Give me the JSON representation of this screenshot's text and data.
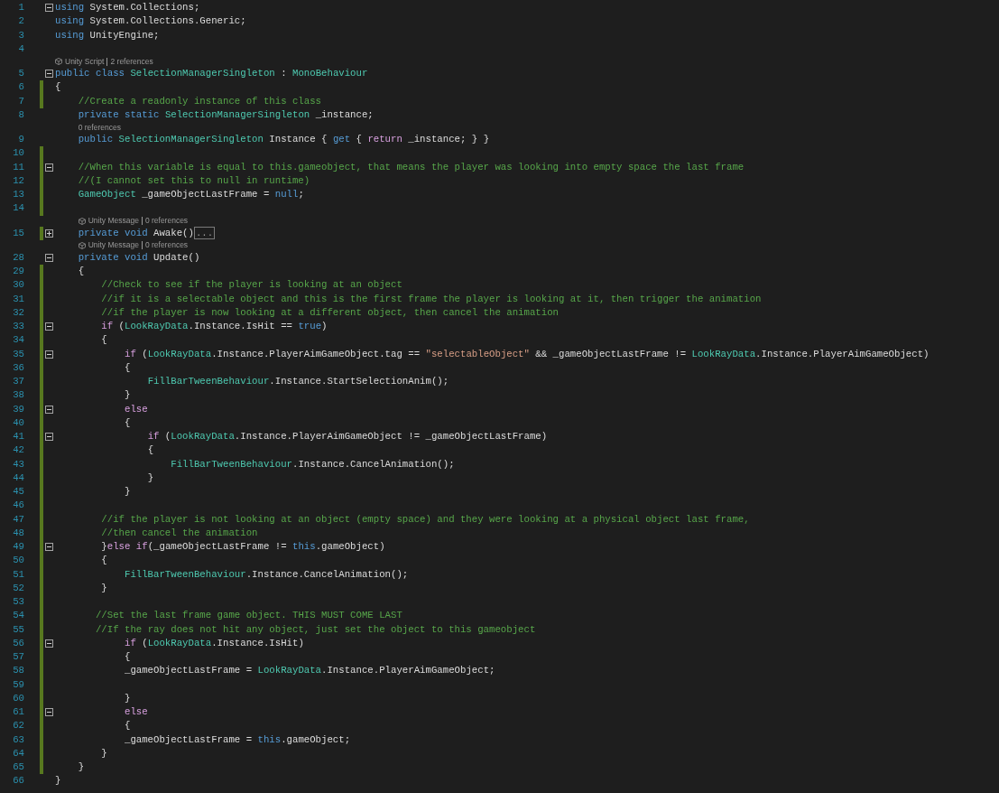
{
  "editor": {
    "lines": [
      {
        "kind": "code",
        "number": "1",
        "modified": false,
        "fold": {
          "expanded": true
        },
        "tokens": [
          {
            "kind": "keyword",
            "text": "using"
          },
          {
            "kind": "plain",
            "text": " System.Collections;"
          }
        ]
      },
      {
        "kind": "code",
        "number": "2",
        "modified": false,
        "tokens": [
          {
            "kind": "keyword",
            "text": "using"
          },
          {
            "kind": "plain",
            "text": " System.Collections.Generic;"
          }
        ]
      },
      {
        "kind": "code",
        "number": "3",
        "modified": false,
        "tokens": [
          {
            "kind": "keyword",
            "text": "using"
          },
          {
            "kind": "plain",
            "text": " UnityEngine;"
          }
        ]
      },
      {
        "kind": "code",
        "number": "4",
        "modified": false
      },
      {
        "kind": "lens",
        "items": [
          {
            "kind": "source",
            "text": "Unity Script"
          },
          {
            "kind": "references",
            "text": "2 references"
          }
        ]
      },
      {
        "kind": "code",
        "number": "5",
        "modified": false,
        "fold": {
          "expanded": true
        },
        "tokens": [
          {
            "kind": "keyword",
            "text": "public class "
          },
          {
            "kind": "type",
            "text": "SelectionManagerSingleton"
          },
          {
            "kind": "plain",
            "text": " : "
          },
          {
            "kind": "type",
            "text": "MonoBehaviour"
          }
        ]
      },
      {
        "kind": "code",
        "number": "6",
        "modified": true,
        "tokens": [
          {
            "kind": "plain",
            "text": "{"
          }
        ]
      },
      {
        "kind": "code",
        "number": "7",
        "modified": true,
        "tokens": [
          {
            "kind": "comment",
            "text": "    //Create a readonly instance of this class"
          }
        ]
      },
      {
        "kind": "code",
        "number": "8",
        "modified": false,
        "tokens": [
          {
            "kind": "keyword",
            "text": "    private static "
          },
          {
            "kind": "type",
            "text": "SelectionManagerSingleton"
          },
          {
            "kind": "plain",
            "text": " _instance;"
          }
        ]
      },
      {
        "kind": "lens",
        "items": [
          {
            "kind": "references",
            "text": "0 references"
          }
        ]
      },
      {
        "kind": "code",
        "number": "9",
        "modified": false,
        "tokens": [
          {
            "kind": "keyword",
            "text": "    public "
          },
          {
            "kind": "type",
            "text": "SelectionManagerSingleton"
          },
          {
            "kind": "plain",
            "text": " Instance { "
          },
          {
            "kind": "keyword",
            "text": "get"
          },
          {
            "kind": "plain",
            "text": " { "
          },
          {
            "kind": "control",
            "text": "return"
          },
          {
            "kind": "plain",
            "text": " _instance; } }"
          }
        ]
      },
      {
        "kind": "code",
        "number": "10",
        "modified": true
      },
      {
        "kind": "code",
        "number": "11",
        "modified": true,
        "fold": {
          "expanded": true
        },
        "tokens": [
          {
            "kind": "comment",
            "text": "    //When this variable is equal to this.gameobject, that means the player was looking into empty space the last frame"
          }
        ]
      },
      {
        "kind": "code",
        "number": "12",
        "modified": true,
        "tokens": [
          {
            "kind": "comment",
            "text": "    //(I cannot set this to null in runtime)"
          }
        ]
      },
      {
        "kind": "code",
        "number": "13",
        "modified": true,
        "tokens": [
          {
            "kind": "type",
            "text": "    GameObject"
          },
          {
            "kind": "plain",
            "text": " _gameObjectLastFrame = "
          },
          {
            "kind": "keyword",
            "text": "null"
          },
          {
            "kind": "plain",
            "text": ";"
          }
        ]
      },
      {
        "kind": "code",
        "number": "14",
        "modified": true
      },
      {
        "kind": "lens",
        "items": [
          {
            "kind": "source",
            "text": "Unity Message"
          },
          {
            "kind": "references",
            "text": "0 references"
          }
        ]
      },
      {
        "kind": "code",
        "number": "15",
        "modified": true,
        "fold": {
          "expanded": false
        },
        "tokens": [
          {
            "kind": "keyword",
            "text": "    private void"
          },
          {
            "kind": "plain",
            "text": " Awake()"
          }
        ],
        "collapsed_indicator": "..."
      },
      {
        "kind": "lens",
        "items": [
          {
            "kind": "source",
            "text": "Unity Message"
          },
          {
            "kind": "references",
            "text": "0 references"
          }
        ]
      },
      {
        "kind": "code",
        "number": "28",
        "modified": false,
        "fold": {
          "expanded": true
        },
        "tokens": [
          {
            "kind": "keyword",
            "text": "    private void"
          },
          {
            "kind": "plain",
            "text": " Update()"
          }
        ]
      },
      {
        "kind": "code",
        "number": "29",
        "modified": true,
        "tokens": [
          {
            "kind": "plain",
            "text": "    {"
          }
        ]
      },
      {
        "kind": "code",
        "number": "30",
        "modified": true,
        "tokens": [
          {
            "kind": "comment",
            "text": "        //Check to see if the player is looking at an object"
          }
        ]
      },
      {
        "kind": "code",
        "number": "31",
        "modified": true,
        "tokens": [
          {
            "kind": "comment",
            "text": "        //if it is a selectable object and this is the first frame the player is looking at it, then trigger the animation"
          }
        ]
      },
      {
        "kind": "code",
        "number": "32",
        "modified": true,
        "tokens": [
          {
            "kind": "comment",
            "text": "        //if the player is now looking at a different object, then cancel the animation"
          }
        ]
      },
      {
        "kind": "code",
        "number": "33",
        "modified": true,
        "fold": {
          "expanded": true
        },
        "tokens": [
          {
            "kind": "control",
            "text": "        if"
          },
          {
            "kind": "plain",
            "text": " ("
          },
          {
            "kind": "type",
            "text": "LookRayData"
          },
          {
            "kind": "plain",
            "text": ".Instance.IsHit == "
          },
          {
            "kind": "keyword",
            "text": "true"
          },
          {
            "kind": "plain",
            "text": ")"
          }
        ]
      },
      {
        "kind": "code",
        "number": "34",
        "modified": true,
        "tokens": [
          {
            "kind": "plain",
            "text": "        {"
          }
        ]
      },
      {
        "kind": "code",
        "number": "35",
        "modified": true,
        "fold": {
          "expanded": true
        },
        "tokens": [
          {
            "kind": "control",
            "text": "            if"
          },
          {
            "kind": "plain",
            "text": " ("
          },
          {
            "kind": "type",
            "text": "LookRayData"
          },
          {
            "kind": "plain",
            "text": ".Instance.PlayerAimGameObject.tag == "
          },
          {
            "kind": "string",
            "text": "\"selectableObject\""
          },
          {
            "kind": "plain",
            "text": " && _gameObjectLastFrame != "
          },
          {
            "kind": "type",
            "text": "LookRayData"
          },
          {
            "kind": "plain",
            "text": ".Instance.PlayerAimGameObject)"
          }
        ]
      },
      {
        "kind": "code",
        "number": "36",
        "modified": true,
        "tokens": [
          {
            "kind": "plain",
            "text": "            {"
          }
        ]
      },
      {
        "kind": "code",
        "number": "37",
        "modified": true,
        "tokens": [
          {
            "kind": "type",
            "text": "                FillBarTweenBehaviour"
          },
          {
            "kind": "plain",
            "text": ".Instance.StartSelectionAnim();"
          }
        ]
      },
      {
        "kind": "code",
        "number": "38",
        "modified": true,
        "tokens": [
          {
            "kind": "plain",
            "text": "            }"
          }
        ]
      },
      {
        "kind": "code",
        "number": "39",
        "modified": true,
        "fold": {
          "expanded": true
        },
        "tokens": [
          {
            "kind": "control",
            "text": "            else"
          }
        ]
      },
      {
        "kind": "code",
        "number": "40",
        "modified": true,
        "tokens": [
          {
            "kind": "plain",
            "text": "            {"
          }
        ]
      },
      {
        "kind": "code",
        "number": "41",
        "modified": true,
        "fold": {
          "expanded": true
        },
        "tokens": [
          {
            "kind": "control",
            "text": "                if"
          },
          {
            "kind": "plain",
            "text": " ("
          },
          {
            "kind": "type",
            "text": "LookRayData"
          },
          {
            "kind": "plain",
            "text": ".Instance.PlayerAimGameObject != _gameObjectLastFrame)"
          }
        ]
      },
      {
        "kind": "code",
        "number": "42",
        "modified": true,
        "tokens": [
          {
            "kind": "plain",
            "text": "                {"
          }
        ]
      },
      {
        "kind": "code",
        "number": "43",
        "modified": true,
        "tokens": [
          {
            "kind": "type",
            "text": "                    FillBarTweenBehaviour"
          },
          {
            "kind": "plain",
            "text": ".Instance.CancelAnimation();"
          }
        ]
      },
      {
        "kind": "code",
        "number": "44",
        "modified": true,
        "tokens": [
          {
            "kind": "plain",
            "text": "                }"
          }
        ]
      },
      {
        "kind": "code",
        "number": "45",
        "modified": true,
        "tokens": [
          {
            "kind": "plain",
            "text": "            }"
          }
        ]
      },
      {
        "kind": "code",
        "number": "46",
        "modified": true
      },
      {
        "kind": "code",
        "number": "47",
        "modified": true,
        "tokens": [
          {
            "kind": "comment",
            "text": "        //if the player is not looking at an object (empty space) and they were looking at a physical object last frame,"
          }
        ]
      },
      {
        "kind": "code",
        "number": "48",
        "modified": true,
        "tokens": [
          {
            "kind": "comment",
            "text": "        //then cancel the animation"
          }
        ]
      },
      {
        "kind": "code",
        "number": "49",
        "modified": true,
        "fold": {
          "expanded": true
        },
        "tokens": [
          {
            "kind": "plain",
            "text": "        }"
          },
          {
            "kind": "control",
            "text": "else if"
          },
          {
            "kind": "plain",
            "text": "(_gameObjectLastFrame != "
          },
          {
            "kind": "keyword",
            "text": "this"
          },
          {
            "kind": "plain",
            "text": ".gameObject)"
          }
        ]
      },
      {
        "kind": "code",
        "number": "50",
        "modified": true,
        "tokens": [
          {
            "kind": "plain",
            "text": "        {"
          }
        ]
      },
      {
        "kind": "code",
        "number": "51",
        "modified": true,
        "tokens": [
          {
            "kind": "type",
            "text": "            FillBarTweenBehaviour"
          },
          {
            "kind": "plain",
            "text": ".Instance.CancelAnimation();"
          }
        ]
      },
      {
        "kind": "code",
        "number": "52",
        "modified": true,
        "tokens": [
          {
            "kind": "plain",
            "text": "        }"
          }
        ]
      },
      {
        "kind": "code",
        "number": "53",
        "modified": true
      },
      {
        "kind": "code",
        "number": "54",
        "modified": true,
        "tokens": [
          {
            "kind": "comment",
            "text": "       //Set the last frame game object. THIS MUST COME LAST"
          }
        ]
      },
      {
        "kind": "code",
        "number": "55",
        "modified": true,
        "tokens": [
          {
            "kind": "comment",
            "text": "       //If the ray does not hit any object, just set the object to this gameobject"
          }
        ]
      },
      {
        "kind": "code",
        "number": "56",
        "modified": true,
        "fold": {
          "expanded": true
        },
        "tokens": [
          {
            "kind": "control",
            "text": "            if"
          },
          {
            "kind": "plain",
            "text": " ("
          },
          {
            "kind": "type",
            "text": "LookRayData"
          },
          {
            "kind": "plain",
            "text": ".Instance.IsHit)"
          }
        ]
      },
      {
        "kind": "code",
        "number": "57",
        "modified": true,
        "tokens": [
          {
            "kind": "plain",
            "text": "            {"
          }
        ]
      },
      {
        "kind": "code",
        "number": "58",
        "modified": true,
        "tokens": [
          {
            "kind": "plain",
            "text": "            _gameObjectLastFrame = "
          },
          {
            "kind": "type",
            "text": "LookRayData"
          },
          {
            "kind": "plain",
            "text": ".Instance.PlayerAimGameObject;"
          }
        ]
      },
      {
        "kind": "code",
        "number": "59",
        "modified": true
      },
      {
        "kind": "code",
        "number": "60",
        "modified": true,
        "tokens": [
          {
            "kind": "plain",
            "text": "            }"
          }
        ]
      },
      {
        "kind": "code",
        "number": "61",
        "modified": true,
        "fold": {
          "expanded": true
        },
        "tokens": [
          {
            "kind": "control",
            "text": "            else"
          }
        ]
      },
      {
        "kind": "code",
        "number": "62",
        "modified": true,
        "tokens": [
          {
            "kind": "plain",
            "text": "            {"
          }
        ]
      },
      {
        "kind": "code",
        "number": "63",
        "modified": true,
        "tokens": [
          {
            "kind": "plain",
            "text": "            _gameObjectLastFrame = "
          },
          {
            "kind": "keyword",
            "text": "this"
          },
          {
            "kind": "plain",
            "text": ".gameObject;"
          }
        ]
      },
      {
        "kind": "code",
        "number": "64",
        "modified": true,
        "tokens": [
          {
            "kind": "plain",
            "text": "        }"
          }
        ]
      },
      {
        "kind": "code",
        "number": "65",
        "modified": true,
        "tokens": [
          {
            "kind": "plain",
            "text": "    }"
          }
        ]
      },
      {
        "kind": "code",
        "number": "66",
        "modified": false,
        "tokens": [
          {
            "kind": "plain",
            "text": "}"
          }
        ]
      }
    ]
  }
}
